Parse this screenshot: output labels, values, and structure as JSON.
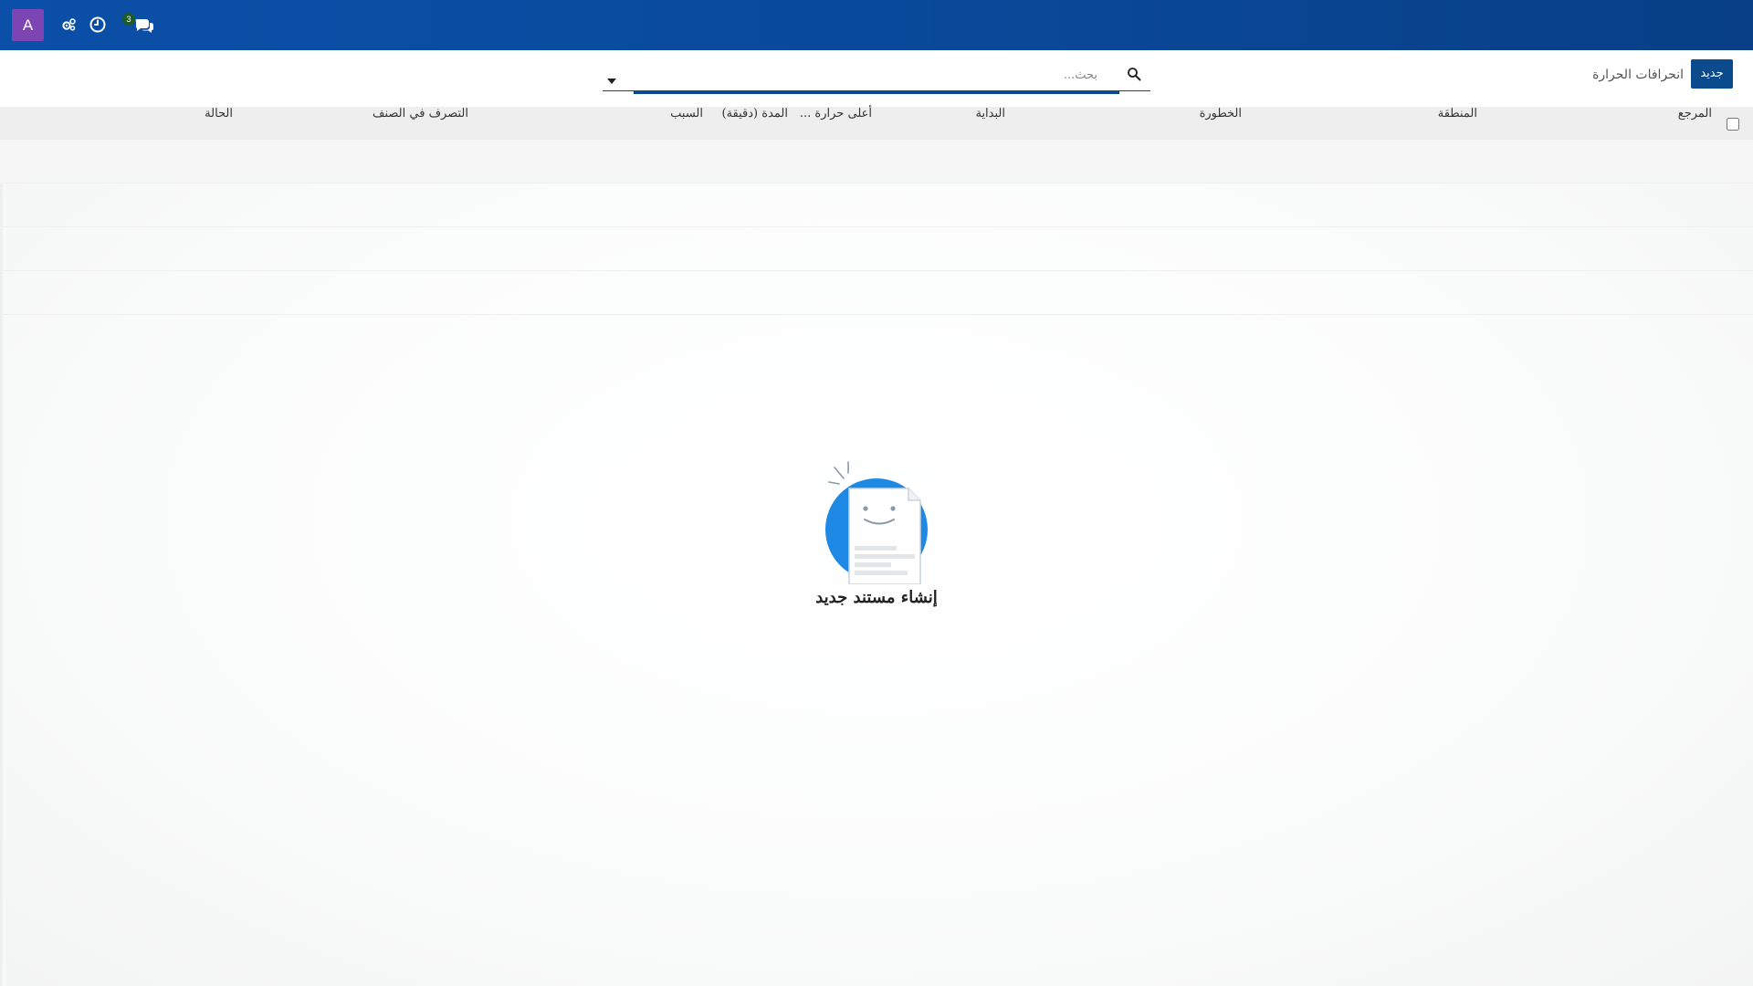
{
  "topbar": {
    "avatar_letter": "A",
    "chat_badge_count": "3",
    "icons": [
      "gears-icon",
      "clock-icon",
      "chat-icon"
    ],
    "background_color": "#0a4fa8"
  },
  "control_panel": {
    "new_button_label": "جديد",
    "breadcrumb": "انحرافات الحرارة",
    "search_placeholder": "بحث...",
    "accent_color": "#0b4a8c"
  },
  "list": {
    "columns": [
      "المرجع",
      "المنطقة",
      "الخطورة",
      "البداية",
      "أعلى حرارة ...",
      "المدة (دقيقة)",
      "السبب",
      "التصرف في الصنف",
      "الحالة"
    ],
    "empty_row_count": 4
  },
  "empty_state": {
    "title": "إنشاء مستند جديد",
    "icon": "smiling-document-icon"
  }
}
